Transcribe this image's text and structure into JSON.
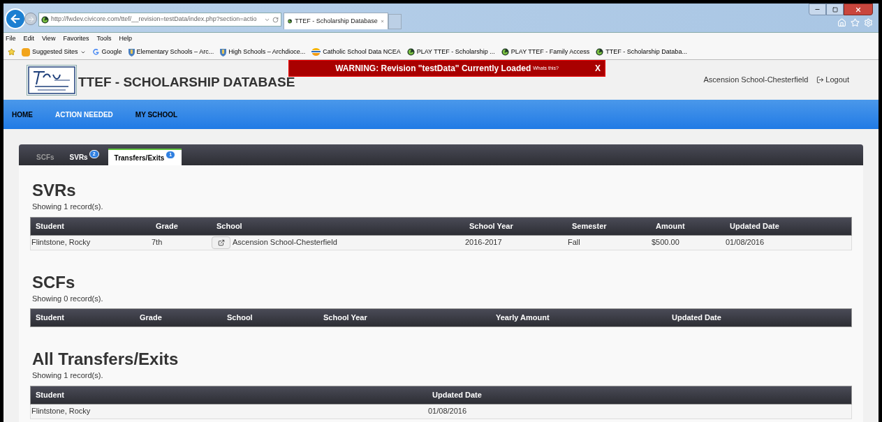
{
  "browser": {
    "address": "http://fwdev.civicore.com/ttef/__revision=testData/index.php?section=actio",
    "tab_title": "TTEF - Scholarship Database",
    "menu": [
      "File",
      "Edit",
      "View",
      "Favorites",
      "Tools",
      "Help"
    ],
    "favorites": [
      {
        "label": "Suggested Sites",
        "kind": "suggested"
      },
      {
        "label": "Google",
        "kind": "google"
      },
      {
        "label": "Elementary Schools – Arc...",
        "kind": "shield"
      },
      {
        "label": "High Schools – Archdioce...",
        "kind": "shield"
      },
      {
        "label": "Catholic School Data  NCEA",
        "kind": "bowl"
      },
      {
        "label": "PLAY TTEF - Scholarship ...",
        "kind": "swirl"
      },
      {
        "label": "PLAY TTEF - Family Access",
        "kind": "swirl"
      },
      {
        "label": "TTEF - Scholarship Databa...",
        "kind": "swirl"
      }
    ]
  },
  "header": {
    "title": "TTEF - SCHOLARSHIP DATABASE",
    "warning": "WARNING: Revision \"testData\" Currently Loaded",
    "warning_link": "Whats this?",
    "warning_close": "X",
    "school": "Ascension School-Chesterfield",
    "logout": "Logout"
  },
  "nav": [
    "HOME",
    "ACTION NEEDED",
    "MY SCHOOL"
  ],
  "tabs": [
    {
      "label": "SCFs",
      "selected": false
    },
    {
      "label": "SVRs",
      "badge": "2",
      "selected": false
    },
    {
      "label": "Transfers/Exits",
      "badge": "1",
      "selected": true
    }
  ],
  "sections": [
    {
      "kind": "svrs",
      "title": "SVRs",
      "count": "Showing 1 record(s).",
      "columns": [
        "Student",
        "Grade",
        "School",
        "School Year",
        "Semester",
        "Amount",
        "Updated Date"
      ],
      "rows": [
        [
          "Flintstone, Rocky",
          "7th",
          "Ascension School-Chesterfield",
          "2016-2017",
          "Fall",
          "$500.00",
          "01/08/2016"
        ]
      ]
    },
    {
      "kind": "scfs",
      "title": "SCFs",
      "count": "Showing 0 record(s).",
      "columns": [
        "Student",
        "Grade",
        "School",
        "School Year",
        "Yearly Amount",
        "Updated Date"
      ]
    },
    {
      "kind": "transfers",
      "title": "All Transfers/Exits",
      "count": "Showing 1 record(s).",
      "columns": [
        "Student",
        "Updated Date"
      ],
      "rows": [
        [
          "Flintstone, Rocky",
          "01/08/2016"
        ]
      ]
    }
  ]
}
